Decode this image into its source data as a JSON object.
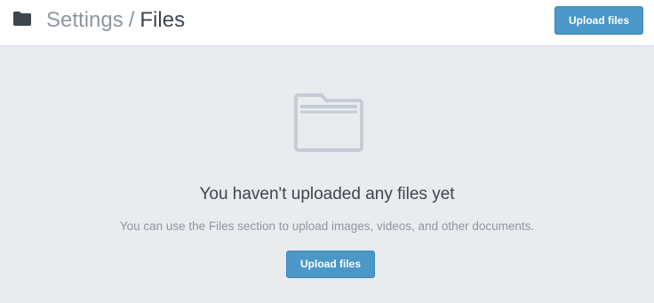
{
  "header": {
    "icon": "folder-icon",
    "breadcrumb": {
      "parent": "Settings",
      "separator": "/",
      "current": "Files"
    },
    "upload_button_label": "Upload files"
  },
  "empty_state": {
    "icon": "folder-outline-icon",
    "title": "You haven't uploaded any files yet",
    "description": "You can use the Files section to upload images, videos, and other documents.",
    "upload_button_label": "Upload files"
  },
  "colors": {
    "accent": "#4a97c8",
    "background": "#e9ecef",
    "header_background": "#ffffff",
    "text_dark": "#3e454d",
    "text_muted": "#8e96a0",
    "icon_outline": "#c5ccd3"
  }
}
